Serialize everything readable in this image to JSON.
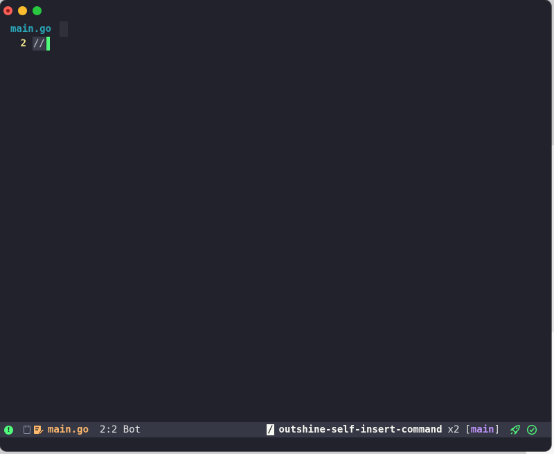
{
  "window": {
    "title_lights": [
      "close",
      "minimize",
      "maximize"
    ]
  },
  "tabline": {
    "active_tab": "main.go"
  },
  "editor": {
    "lines": [
      {
        "number": "2",
        "text": "//"
      }
    ]
  },
  "modeline": {
    "status_indicator": "!",
    "buffer_icon": "modified-file-icon",
    "file_name": "main.go",
    "position": "2:2 Bot",
    "slash": "/",
    "command": "outshine-self-insert-command",
    "repeat_count": "x2",
    "branch_open": "[",
    "branch": "main",
    "branch_close": "]",
    "end_icons": [
      "rocket-icon",
      "check-circle-icon"
    ]
  },
  "colors": {
    "background": "#21222c",
    "modeline": "#363845",
    "accent_green": "#50fa7b",
    "file_orange": "#ffb86c",
    "branch_purple": "#bd93f9",
    "tab_teal": "#2aa6b7"
  }
}
